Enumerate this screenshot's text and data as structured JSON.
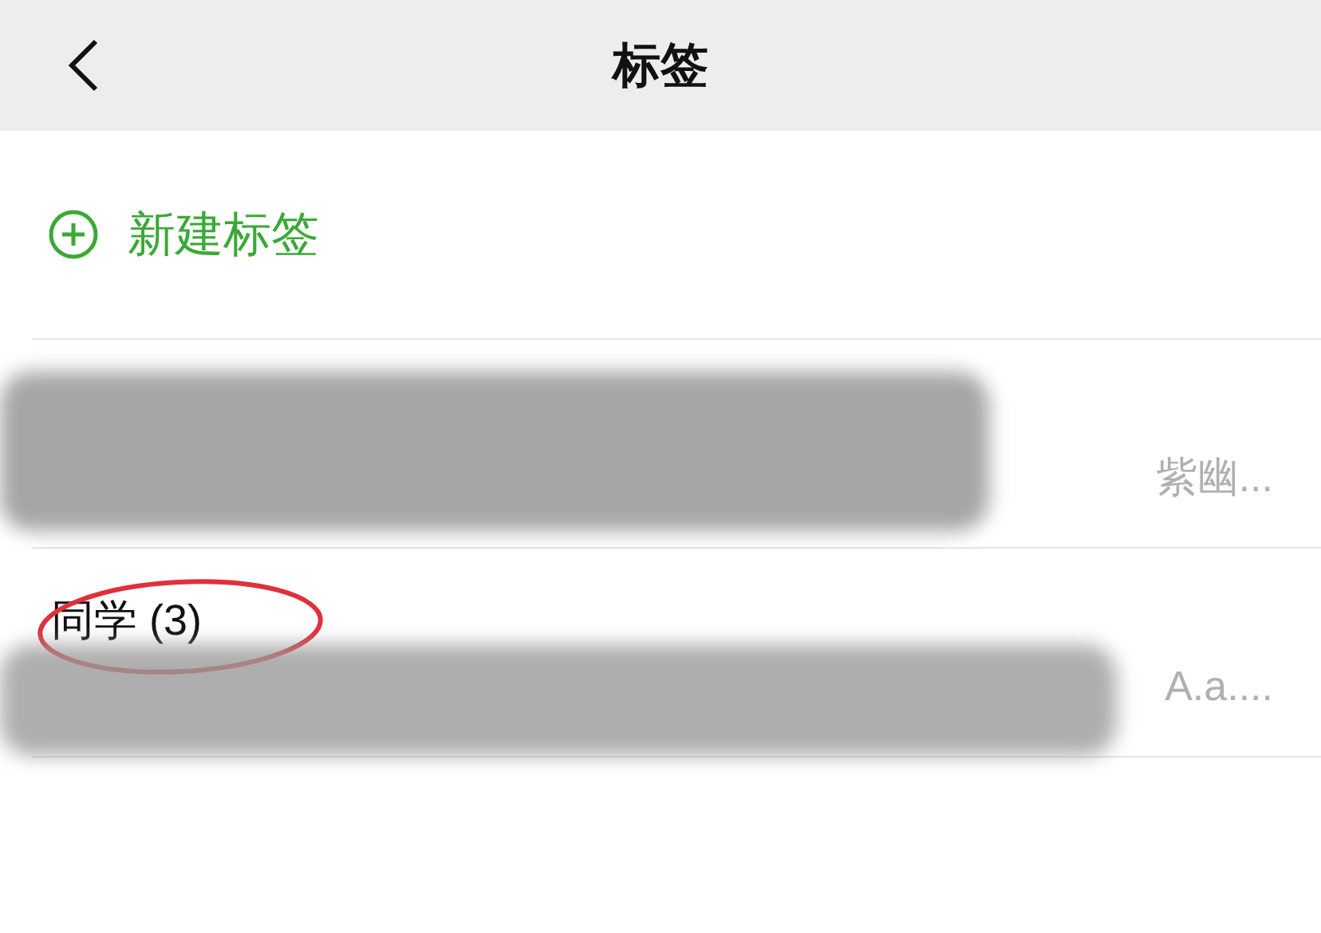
{
  "nav_bar": {
    "title": "标签"
  },
  "new_tag": {
    "label": "新建标签"
  },
  "tags": [
    {
      "members": "紫幽...",
      "redacted": true,
      "annotated": false
    },
    {
      "name": "同学 (3)",
      "members": "A.a....",
      "redacted": true,
      "annotated": true
    }
  ]
}
